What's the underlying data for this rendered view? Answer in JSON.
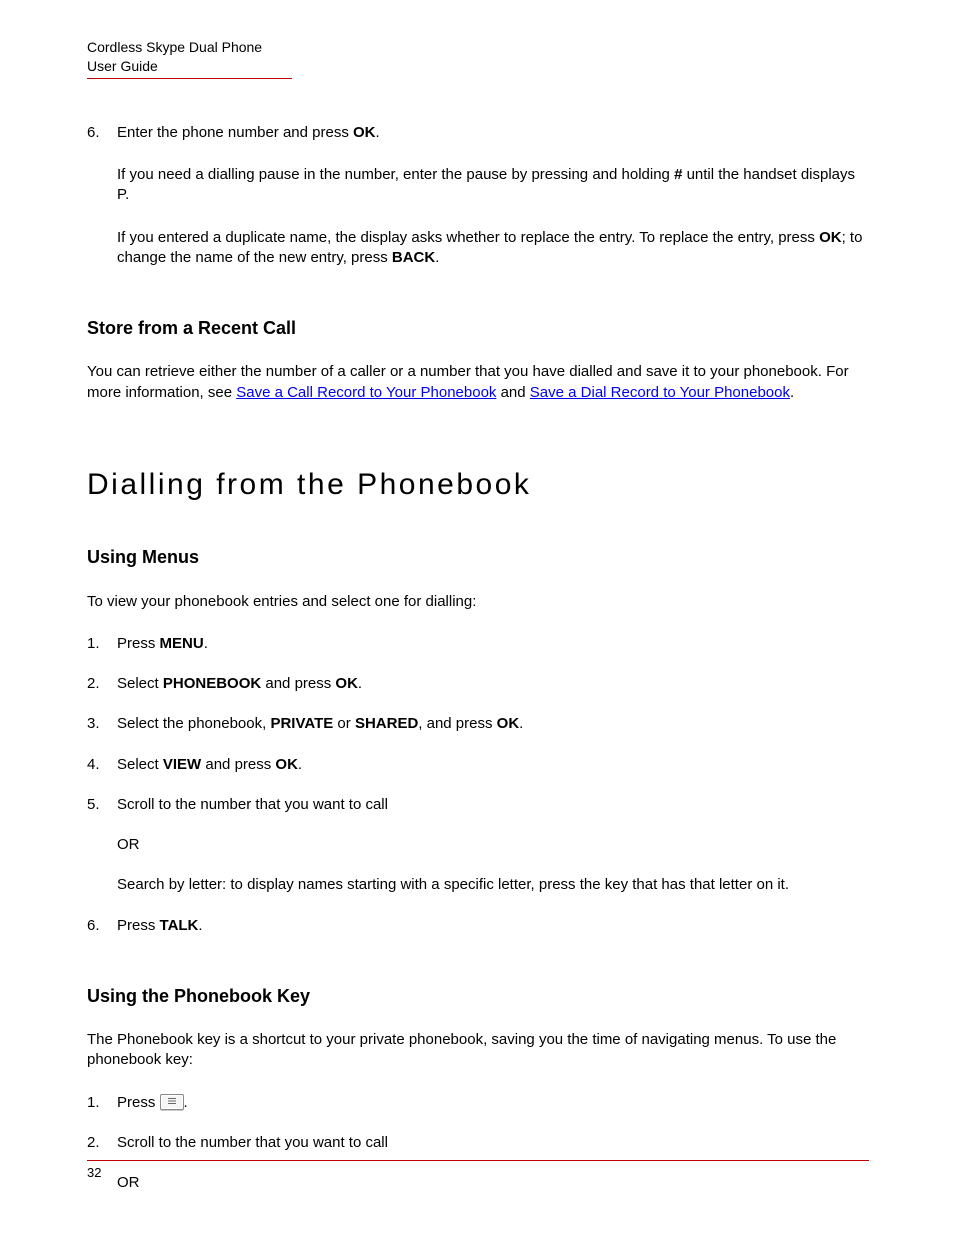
{
  "header": {
    "line1": "Cordless Skype Dual Phone",
    "line2": "User Guide"
  },
  "continued_list": {
    "item6": {
      "num": "6.",
      "text_pre": "Enter the phone number and press ",
      "key1": "OK",
      "text_post": ".",
      "para2_pre": "If you need a dialling pause in the number, enter the pause by pressing and holding ",
      "para2_key": "#",
      "para2_post": " until the handset displays P.",
      "para3_pre": "If you entered a duplicate name, the display asks whether to replace the entry. To replace the entry, press ",
      "para3_key1": "OK",
      "para3_mid": "; to change the name of the new entry, press ",
      "para3_key2": "BACK",
      "para3_post": "."
    }
  },
  "section_store": {
    "title": "Store from a Recent Call",
    "p1_a": "You can retrieve either the number of a caller or a number that you have dialled and save it to your phonebook. For more information, see ",
    "link1": "Save a Call Record to Your Phonebook",
    "p1_b": " and ",
    "link2": "Save a Dial Record to Your Phonebook",
    "p1_c": "."
  },
  "h2": "Dialling from the Phonebook",
  "section_menus": {
    "title": "Using Menus",
    "intro": "To view your phonebook entries and select one for dialling:",
    "steps": [
      {
        "num": "1.",
        "pre": "Press ",
        "b1": "MENU",
        "post": "."
      },
      {
        "num": "2.",
        "pre": "Select ",
        "b1": "PHONEBOOK",
        "mid": " and press ",
        "b2": "OK",
        "post": "."
      },
      {
        "num": "3.",
        "pre": "Select the phonebook, ",
        "b1": "PRIVATE",
        "mid": " or ",
        "b2": "SHARED",
        "mid2": ", and press ",
        "b3": "OK",
        "post": "."
      },
      {
        "num": "4.",
        "pre": "Select ",
        "b1": "VIEW",
        "mid": " and press ",
        "b2": "OK",
        "post": "."
      },
      {
        "num": "5.",
        "pre": "Scroll to the number that you want to call",
        "sub_or": "OR",
        "sub2": "Search by letter: to display names starting with a specific letter, press the key that has that letter on it."
      },
      {
        "num": "6.",
        "pre": "Press ",
        "b1": "TALK",
        "post": "."
      }
    ]
  },
  "section_pbkey": {
    "title": "Using the Phonebook Key",
    "intro": "The Phonebook key is a shortcut to your private phonebook, saving you the time of navigating menus. To use the phonebook key:",
    "steps": [
      {
        "num": "1.",
        "pre": "Press ",
        "icon": "phonebook-key-icon",
        "post": "."
      },
      {
        "num": "2.",
        "pre": "Scroll to the number that you want to call",
        "sub_or": "OR"
      }
    ]
  },
  "page_number": "32"
}
